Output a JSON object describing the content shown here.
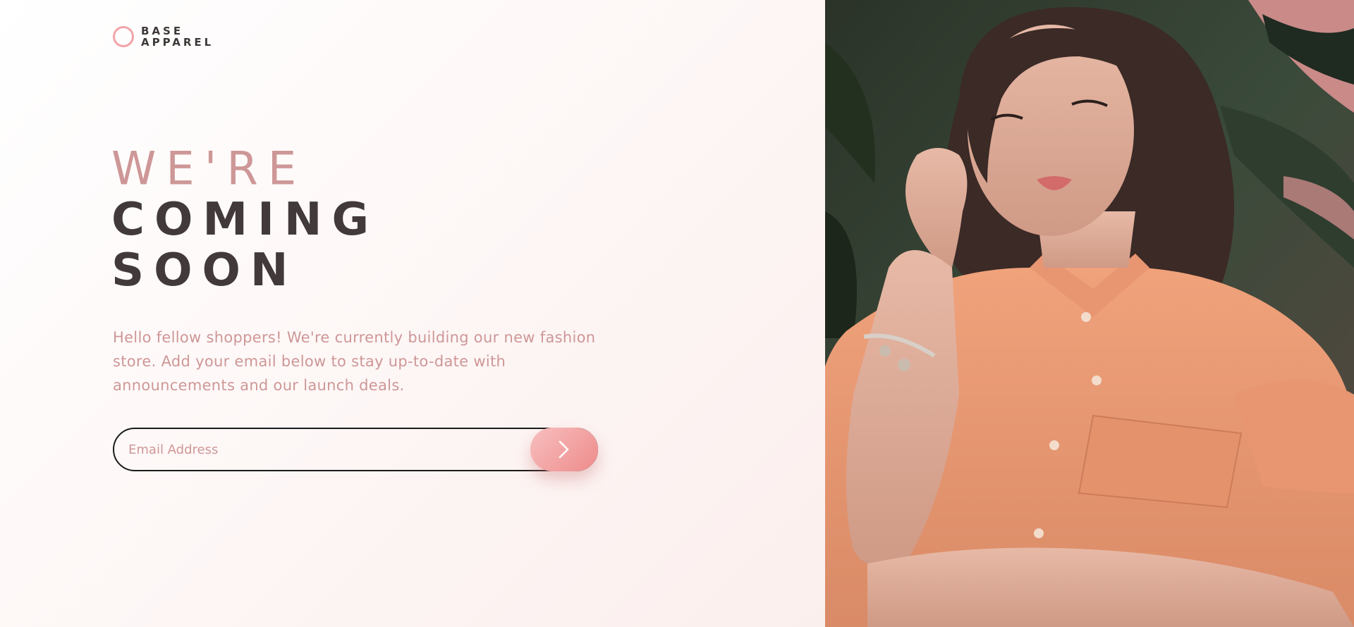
{
  "brand": {
    "line1": "BASE",
    "line2": "APPAREL",
    "accent_color": "#f2a4a8"
  },
  "hero": {
    "line1": "WE'RE",
    "line2": "COMING",
    "line3": "SOON"
  },
  "intro": {
    "text": "Hello fellow shoppers! We're currently building our new fashion store. Add your email below to stay up-to-date with announcements and our launch deals."
  },
  "form": {
    "email_placeholder": "Email Address",
    "submit_icon": "chevron-right-icon"
  },
  "colors": {
    "text_pink": "#ce9797",
    "text_dark": "#423a3a",
    "button_gradient_start": "#f8bfbf",
    "button_gradient_end": "#ee8b8b"
  },
  "hero_image": {
    "icon": "model-photo"
  }
}
